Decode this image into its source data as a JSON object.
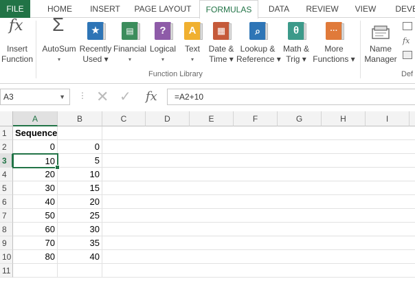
{
  "tabs": [
    "FILE",
    "HOME",
    "INSERT",
    "PAGE LAYOUT",
    "FORMULAS",
    "DATA",
    "REVIEW",
    "VIEW",
    "DEVEL"
  ],
  "active_tab": "FORMULAS",
  "ribbon": {
    "insert_function": [
      "Insert",
      "Function"
    ],
    "autosum": [
      "AutoSum",
      "▾"
    ],
    "recently_used": [
      "Recently",
      "Used ▾"
    ],
    "financial": [
      "Financial",
      "▾"
    ],
    "logical": [
      "Logical",
      "▾"
    ],
    "text": [
      "Text",
      "▾"
    ],
    "date_time": [
      "Date &",
      "Time ▾"
    ],
    "lookup": [
      "Lookup &",
      "Reference ▾"
    ],
    "math_trig": [
      "Math &",
      "Trig ▾"
    ],
    "more_functions": [
      "More",
      "Functions ▾"
    ],
    "name_manager": [
      "Name",
      "Manager"
    ],
    "group_function_library": "Function Library",
    "group_defined_names": "Def"
  },
  "name_box": "A3",
  "formula": "=A2+10",
  "columns": [
    "A",
    "B",
    "C",
    "D",
    "E",
    "F",
    "G",
    "H",
    "I"
  ],
  "rows": [
    "1",
    "2",
    "3",
    "4",
    "5",
    "6",
    "7",
    "8",
    "9",
    "10",
    "11"
  ],
  "cells": {
    "A1": "Sequence",
    "A2": "0",
    "B2": "0",
    "A3": "10",
    "B3": "5",
    "A4": "20",
    "B4": "10",
    "A5": "30",
    "B5": "15",
    "A6": "40",
    "B6": "20",
    "A7": "50",
    "B7": "25",
    "A8": "60",
    "B8": "30",
    "A9": "70",
    "B9": "35",
    "A10": "80",
    "B10": "40"
  },
  "colors": {
    "accent": "#217346"
  }
}
